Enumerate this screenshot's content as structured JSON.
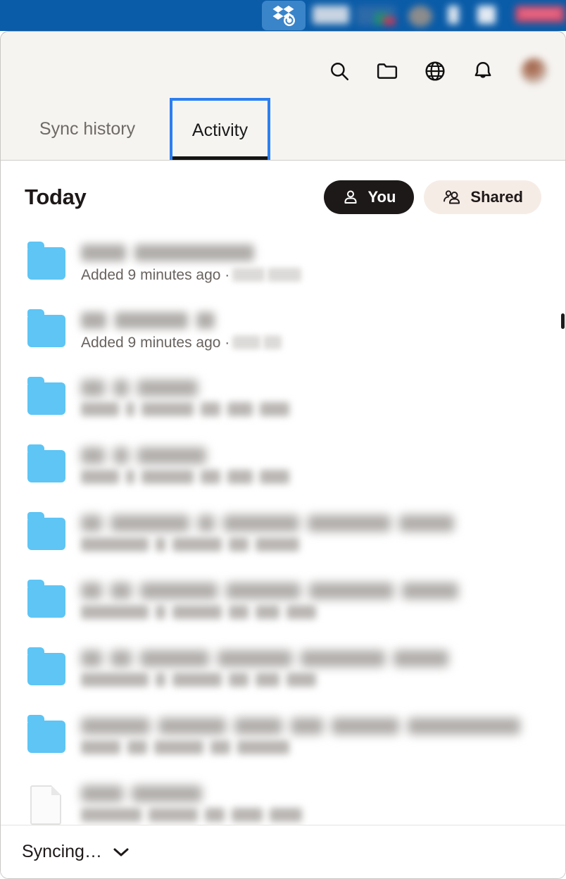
{
  "menubar": {
    "app_icon": "dropbox-syncing-icon",
    "background_color": "#0a5ca8",
    "dropbox_tile_color": "#3a84c9"
  },
  "header": {
    "background_color": "#f6f4f1",
    "icons": [
      {
        "name": "search-icon",
        "label": "Search"
      },
      {
        "name": "folder-icon",
        "label": "Open Dropbox folder"
      },
      {
        "name": "globe-icon",
        "label": "Open dropbox.com"
      },
      {
        "name": "bell-icon",
        "label": "Notifications"
      },
      {
        "name": "avatar",
        "label": "Account"
      }
    ],
    "tabs": [
      {
        "label": "Sync history",
        "active": false
      },
      {
        "label": "Activity",
        "active": true
      }
    ],
    "active_tab_highlight_color": "#2a7ff0",
    "active_tab_underline_color": "#141414"
  },
  "main": {
    "section_title": "Today",
    "filters": [
      {
        "label": "You",
        "icon": "person-icon",
        "active": true,
        "bg": "#1e1919",
        "fg": "#ffffff"
      },
      {
        "label": "Shared",
        "icon": "people-icon",
        "active": false,
        "bg": "#f6ece6",
        "fg": "#1e1919"
      }
    ],
    "rows": [
      {
        "icon": "folder-icon",
        "title_redacted": true,
        "title": "",
        "subtitle_prefix": "Added 9 minutes ago ·",
        "subtitle_suffix_redacted": true,
        "subtitle_redacted": false
      },
      {
        "icon": "folder-icon",
        "title_redacted": true,
        "title": "",
        "subtitle_prefix": "Added 9 minutes ago ·",
        "subtitle_suffix_redacted": true,
        "subtitle_redacted": false
      },
      {
        "icon": "folder-icon",
        "title_redacted": true,
        "title": "",
        "subtitle_prefix": "",
        "subtitle_suffix_redacted": true,
        "subtitle_redacted": true
      },
      {
        "icon": "folder-icon",
        "title_redacted": true,
        "title": "",
        "subtitle_prefix": "",
        "subtitle_suffix_redacted": true,
        "subtitle_redacted": true
      },
      {
        "icon": "folder-icon",
        "title_redacted": true,
        "title": "",
        "subtitle_prefix": "",
        "subtitle_suffix_redacted": true,
        "subtitle_redacted": true
      },
      {
        "icon": "folder-icon",
        "title_redacted": true,
        "title": "",
        "subtitle_prefix": "",
        "subtitle_suffix_redacted": true,
        "subtitle_redacted": true
      },
      {
        "icon": "folder-icon",
        "title_redacted": true,
        "title": "",
        "subtitle_prefix": "",
        "subtitle_suffix_redacted": true,
        "subtitle_redacted": true
      },
      {
        "icon": "folder-icon",
        "title_redacted": true,
        "title": "",
        "subtitle_prefix": "",
        "subtitle_suffix_redacted": true,
        "subtitle_redacted": true
      },
      {
        "icon": "document-icon",
        "title_redacted": true,
        "title": "",
        "subtitle_prefix": "",
        "subtitle_suffix_redacted": true,
        "subtitle_redacted": true
      }
    ],
    "folder_icon_color": "#5ec5f5"
  },
  "footer": {
    "status_label": "Syncing…",
    "chevron": "chevron-down-icon"
  }
}
